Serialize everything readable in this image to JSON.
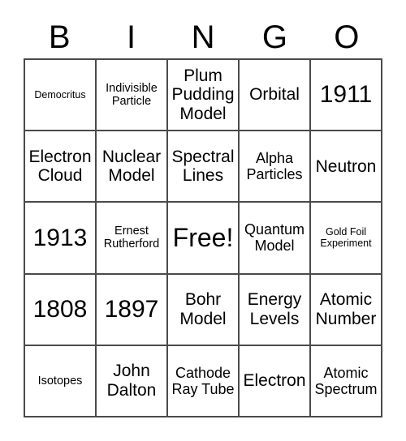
{
  "card": {
    "title": "BINGO",
    "header_letters": [
      "B",
      "I",
      "N",
      "G",
      "O"
    ],
    "rows": [
      [
        {
          "text": "Democritus",
          "size": "xs"
        },
        {
          "text": "Indivisible Particle",
          "size": "sm"
        },
        {
          "text": "Plum Pudding Model",
          "size": "lg"
        },
        {
          "text": "Orbital",
          "size": "lg"
        },
        {
          "text": "1911",
          "size": "xl"
        }
      ],
      [
        {
          "text": "Electron Cloud",
          "size": "lg"
        },
        {
          "text": "Nuclear Model",
          "size": "lg"
        },
        {
          "text": "Spectral Lines",
          "size": "lg"
        },
        {
          "text": "Alpha Particles",
          "size": "md"
        },
        {
          "text": "Neutron",
          "size": "lg"
        }
      ],
      [
        {
          "text": "1913",
          "size": "xl"
        },
        {
          "text": "Ernest Rutherford",
          "size": "sm"
        },
        {
          "text": "Free!",
          "size": "xxl"
        },
        {
          "text": "Quantum Model",
          "size": "md"
        },
        {
          "text": "Gold Foil Experiment",
          "size": "xs"
        }
      ],
      [
        {
          "text": "1808",
          "size": "xl"
        },
        {
          "text": "1897",
          "size": "xl"
        },
        {
          "text": "Bohr Model",
          "size": "lg"
        },
        {
          "text": "Energy Levels",
          "size": "lg"
        },
        {
          "text": "Atomic Number",
          "size": "lg"
        }
      ],
      [
        {
          "text": "Isotopes",
          "size": "sm"
        },
        {
          "text": "John Dalton",
          "size": "lg"
        },
        {
          "text": "Cathode Ray Tube",
          "size": "md"
        },
        {
          "text": "Electron",
          "size": "lg"
        },
        {
          "text": "Atomic Spectrum",
          "size": "md"
        }
      ]
    ],
    "free_space": {
      "row": 2,
      "col": 2,
      "label": "Free!"
    },
    "colors": {
      "background": "#ffffff",
      "text": "#000000",
      "grid_line": "#4a4a4a"
    }
  }
}
